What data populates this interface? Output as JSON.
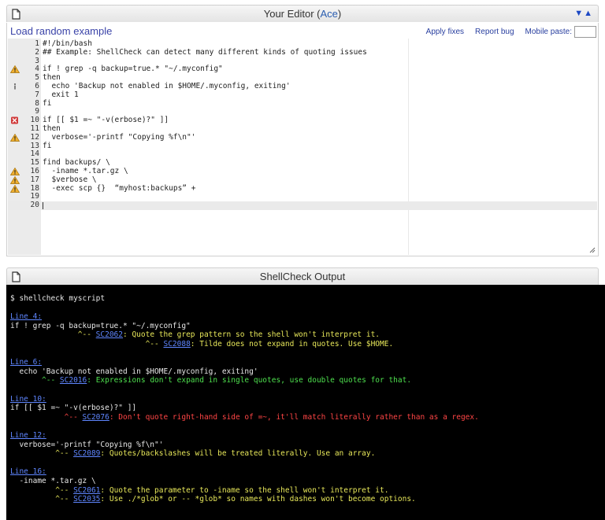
{
  "editor": {
    "title_prefix": "Your Editor (",
    "title_link": "Ace",
    "title_suffix": ")",
    "arrows": "▼▲",
    "load_random": "Load random example",
    "apply_fixes": "Apply fixes",
    "report_bug": "Report bug",
    "mobile_paste": "Mobile paste:",
    "lines": [
      {
        "num": "1",
        "text": "#!/bin/bash",
        "ann": ""
      },
      {
        "num": "2",
        "text": "## Example: ShellCheck can detect many different kinds of quoting issues",
        "ann": ""
      },
      {
        "num": "3",
        "text": "",
        "ann": ""
      },
      {
        "num": "4",
        "text": "if ! grep -q backup=true.* \"~/.myconfig\"",
        "ann": "warning"
      },
      {
        "num": "5",
        "text": "then",
        "ann": ""
      },
      {
        "num": "6",
        "text": "  echo 'Backup not enabled in $HOME/.myconfig, exiting'",
        "ann": "info"
      },
      {
        "num": "7",
        "text": "  exit 1",
        "ann": ""
      },
      {
        "num": "8",
        "text": "fi",
        "ann": ""
      },
      {
        "num": "9",
        "text": "",
        "ann": ""
      },
      {
        "num": "10",
        "text": "if [[ $1 =~ \"-v(erbose)?\" ]]",
        "ann": "error"
      },
      {
        "num": "11",
        "text": "then",
        "ann": ""
      },
      {
        "num": "12",
        "text": "  verbose='-printf \"Copying %f\\n\"'",
        "ann": "warning"
      },
      {
        "num": "13",
        "text": "fi",
        "ann": ""
      },
      {
        "num": "14",
        "text": "",
        "ann": ""
      },
      {
        "num": "15",
        "text": "find backups/ \\",
        "ann": ""
      },
      {
        "num": "16",
        "text": "  -iname *.tar.gz \\",
        "ann": "warning"
      },
      {
        "num": "17",
        "text": "  $verbose \\",
        "ann": "warning"
      },
      {
        "num": "18",
        "text": "  -exec scp {}  “myhost:backups” +",
        "ann": "warning"
      },
      {
        "num": "19",
        "text": "",
        "ann": ""
      },
      {
        "num": "20",
        "text": "",
        "ann": ""
      }
    ]
  },
  "output": {
    "title": "ShellCheck Output",
    "command": "$ shellcheck myscript",
    "blocks": [
      {
        "link": "Line 4:",
        "code": "if ! grep -q backup=true.* \"~/.myconfig\"",
        "msgs": [
          {
            "indent": "               ",
            "prefix": "^-- ",
            "code": "SC2062",
            "text": ": Quote the grep pattern so the shell won't interpret it.",
            "color": "yellow"
          },
          {
            "indent": "                              ",
            "prefix": "^-- ",
            "code": "SC2088",
            "text": ": Tilde does not expand in quotes. Use $HOME.",
            "color": "yellow"
          }
        ]
      },
      {
        "link": "Line 6:",
        "code": "  echo 'Backup not enabled in $HOME/.myconfig, exiting'",
        "msgs": [
          {
            "indent": "       ",
            "prefix": "^-- ",
            "code": "SC2016",
            "text": ": Expressions don't expand in single quotes, use double quotes for that.",
            "color": "green"
          }
        ]
      },
      {
        "link": "Line 10:",
        "code": "if [[ $1 =~ \"-v(erbose)?\" ]]",
        "msgs": [
          {
            "indent": "            ",
            "prefix": "^-- ",
            "code": "SC2076",
            "text": ": Don't quote right-hand side of =~, it'll match literally rather than as a regex.",
            "color": "red"
          }
        ]
      },
      {
        "link": "Line 12:",
        "code": "  verbose='-printf \"Copying %f\\n\"'",
        "msgs": [
          {
            "indent": "          ",
            "prefix": "^-- ",
            "code": "SC2089",
            "text": ": Quotes/backslashes will be treated literally. Use an array.",
            "color": "yellow"
          }
        ]
      },
      {
        "link": "Line 16:",
        "code": "  -iname *.tar.gz \\",
        "msgs": [
          {
            "indent": "          ",
            "prefix": "^-- ",
            "code": "SC2061",
            "text": ": Quote the parameter to -iname so the shell won't interpret it.",
            "color": "yellow"
          },
          {
            "indent": "          ",
            "prefix": "^-- ",
            "code": "SC2035",
            "text": ": Use ./*glob* or -- *glob* so names with dashes won't become options.",
            "color": "yellow"
          }
        ]
      }
    ]
  }
}
